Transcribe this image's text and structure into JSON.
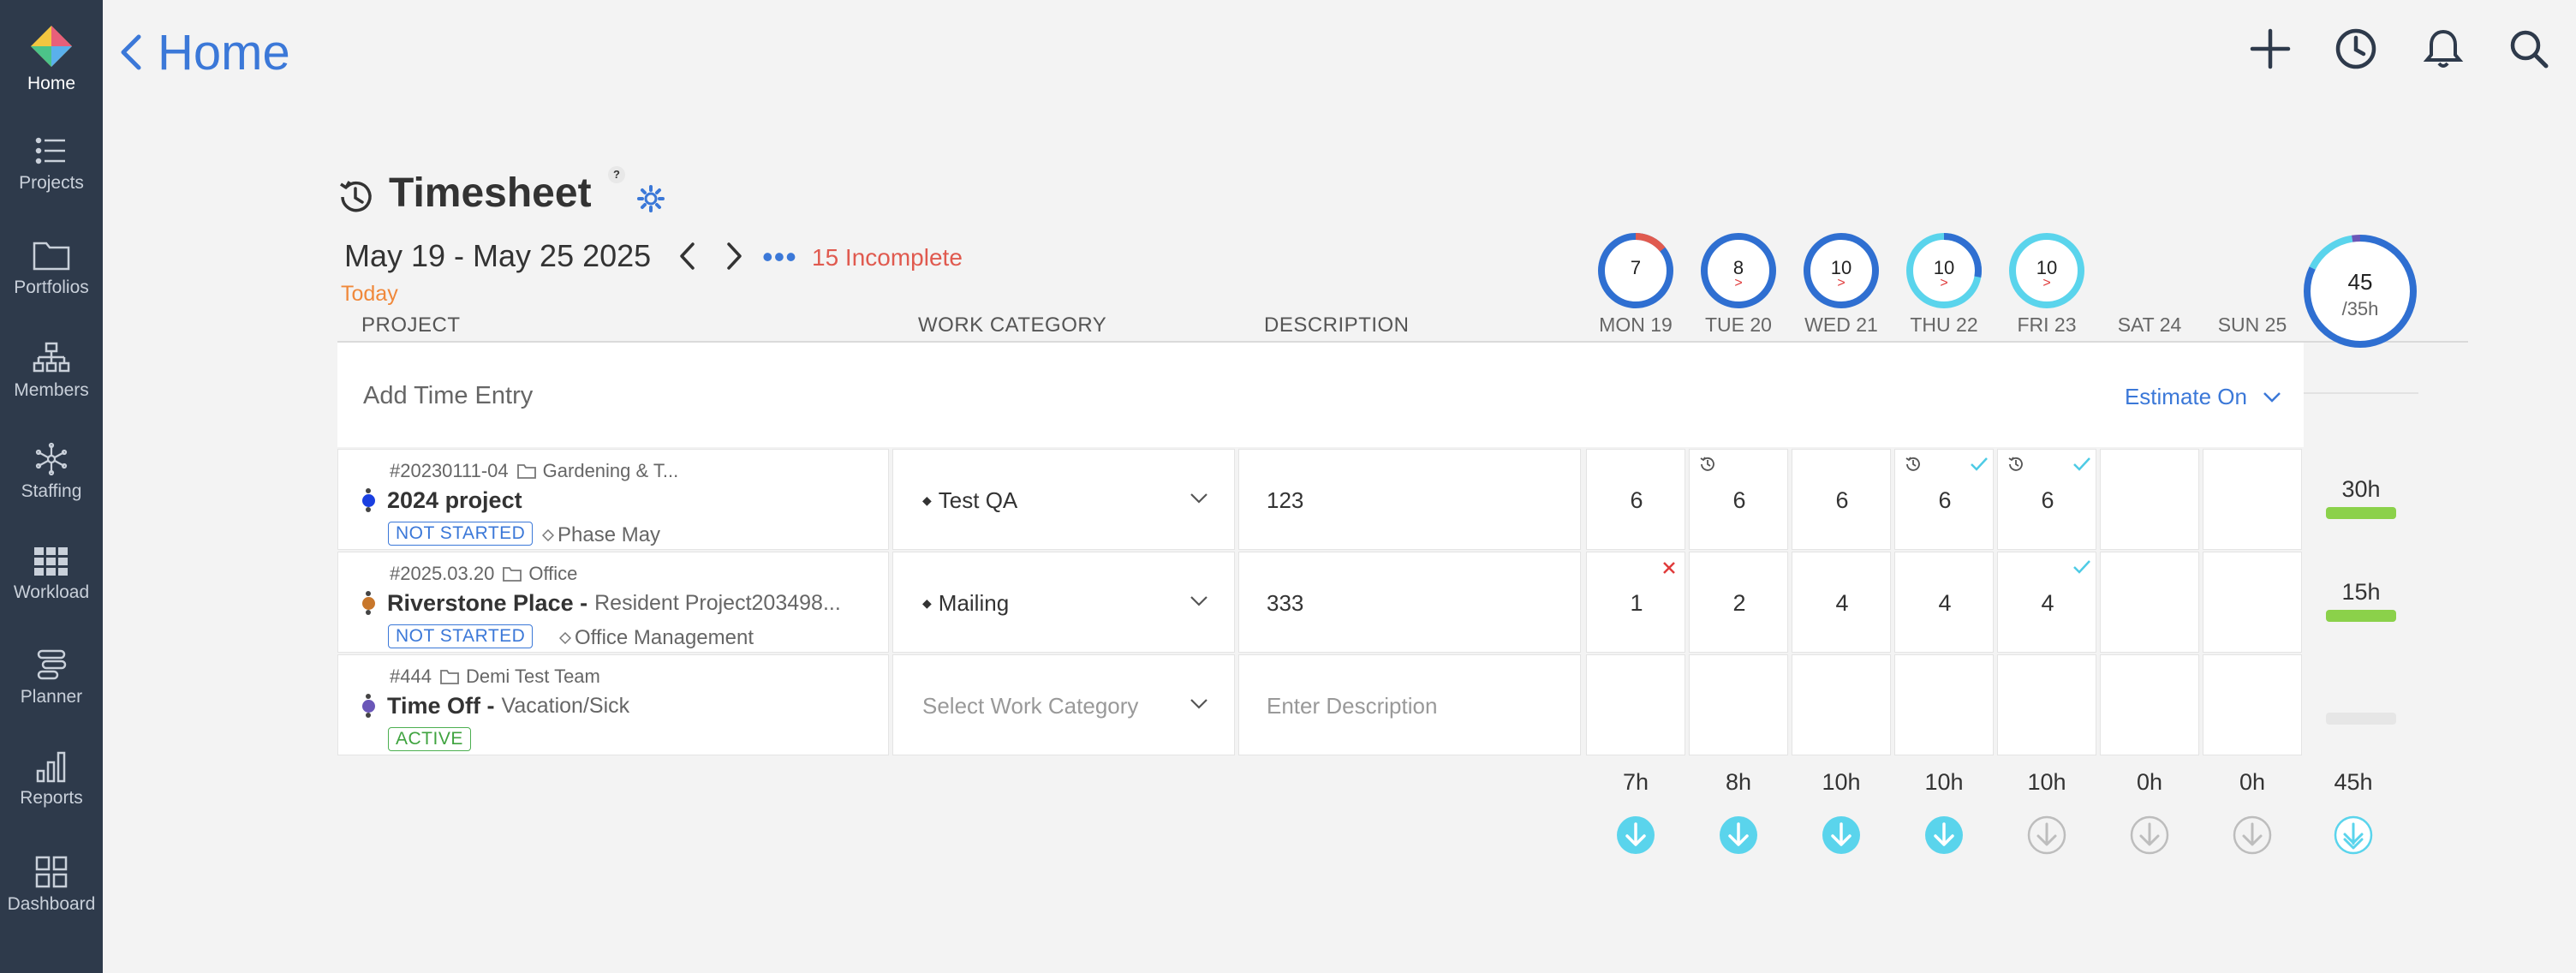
{
  "sidebar": {
    "items": [
      {
        "label": "Home",
        "icon": "home-logo-icon"
      },
      {
        "label": "Projects",
        "icon": "list-icon"
      },
      {
        "label": "Portfolios",
        "icon": "folder-icon"
      },
      {
        "label": "Members",
        "icon": "org-chart-icon"
      },
      {
        "label": "Staffing",
        "icon": "network-icon"
      },
      {
        "label": "Workload",
        "icon": "grid-icon"
      },
      {
        "label": "Planner",
        "icon": "planner-icon"
      },
      {
        "label": "Reports",
        "icon": "bar-chart-icon"
      },
      {
        "label": "Dashboard",
        "icon": "dashboard-icon"
      }
    ]
  },
  "topbar": {
    "back_label": "Home",
    "actions": [
      "plus-icon",
      "clock-icon",
      "bell-icon",
      "search-icon"
    ]
  },
  "header": {
    "title": "Timesheet",
    "help": "?",
    "date_range": "May 19 - May 25 2025",
    "more": "•••",
    "incomplete": "15 Incomplete",
    "today": "Today"
  },
  "columns": {
    "project": "PROJECT",
    "work_category": "WORK CATEGORY",
    "description": "DESCRIPTION"
  },
  "days": [
    {
      "label": "MON 19",
      "hours": "7",
      "caret": ""
    },
    {
      "label": "TUE 20",
      "hours": "8",
      "caret": ">"
    },
    {
      "label": "WED 21",
      "hours": "10",
      "caret": ">"
    },
    {
      "label": "THU 22",
      "hours": "10",
      "caret": ">"
    },
    {
      "label": "FRI 23",
      "hours": "10",
      "caret": ">"
    },
    {
      "label": "SAT 24",
      "hours": "",
      "caret": ""
    },
    {
      "label": "SUN 25",
      "hours": "",
      "caret": ""
    }
  ],
  "week_total": {
    "hours": "45",
    "target": "/35h"
  },
  "add_entry": {
    "label": "Add Time Entry",
    "estimate": "Estimate On"
  },
  "rows": [
    {
      "number": "#20230111-04",
      "folder": "Gardening & T...",
      "name": "2024 project",
      "subname": "",
      "dot_color": "#1a3fe0",
      "status": "NOT STARTED",
      "phase": "Phase May",
      "category": "Test QA",
      "description": "123",
      "values": [
        "6",
        "6",
        "6",
        "6",
        "6",
        "",
        ""
      ],
      "total": "30h",
      "bar_color": "#8bd14a"
    },
    {
      "number": "#2025.03.20",
      "folder": "Office",
      "name": "Riverstone Place -",
      "subname": "Resident Project203498...",
      "dot_color": "#c8772b",
      "status": "NOT STARTED",
      "phase": "Office Management",
      "category": "Mailing",
      "description": "333",
      "values": [
        "1",
        "2",
        "4",
        "4",
        "4",
        "",
        ""
      ],
      "total": "15h",
      "bar_color": "#8bd14a"
    },
    {
      "number": "#444",
      "folder": "Demi Test Team",
      "name": "Time Off -",
      "subname": "Vacation/Sick",
      "dot_color": "#6a57b8",
      "status": "ACTIVE",
      "phase": "",
      "category_placeholder": "Select Work Category",
      "description_placeholder": "Enter Description",
      "values": [
        "",
        "",
        "",
        "",
        "",
        "",
        ""
      ],
      "total": "",
      "bar_color": "#e6e6e6"
    }
  ],
  "footer_totals": [
    "7h",
    "8h",
    "10h",
    "10h",
    "10h",
    "0h",
    "0h",
    "45h"
  ],
  "colors": {
    "sidebar": "#2e3a4b",
    "accent": "#3b78d8",
    "ring_blue": "#2f6fd1",
    "ring_cyan": "#5ad4ec",
    "warning": "#e05a4f",
    "today": "#f0883a"
  }
}
